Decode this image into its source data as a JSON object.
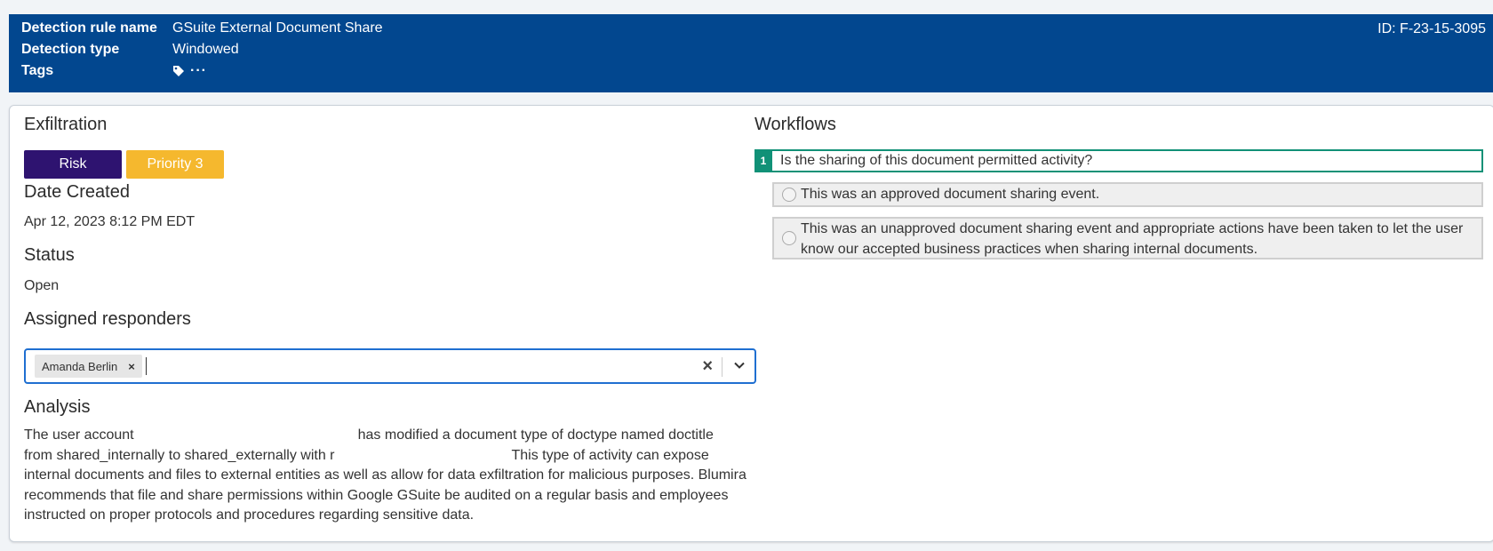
{
  "header": {
    "rule_name_label": "Detection rule name",
    "rule_name_value": "GSuite External Document Share",
    "type_label": "Detection type",
    "type_value": "Windowed",
    "tags_label": "Tags",
    "tags_more": "···",
    "id": "ID: F-23-15-3095",
    "tag_icon": "tag-icon"
  },
  "left": {
    "category": "Exfiltration",
    "badges": {
      "risk": "Risk",
      "priority": "Priority 3"
    },
    "date_created": {
      "label": "Date Created",
      "value": "Apr 12, 2023 8:12 PM EDT"
    },
    "status": {
      "label": "Status",
      "value": "Open"
    },
    "assigned": {
      "label": "Assigned responders",
      "chip": "Amanda Berlin",
      "chip_remove": "×",
      "clear": "×"
    },
    "analysis": {
      "label": "Analysis",
      "line1_a": "The user account",
      "line1_b": "has modified a document type of doctype named doctitle",
      "line2_a": "from shared_internally to shared_externally with r",
      "line2_b": "This type of activity can expose",
      "line3": "internal documents and files to external entities as well as allow for data exfiltration for malicious purposes. Blumira",
      "line4": "recommends that file and share permissions within Google GSuite be audited on a regular basis and employees",
      "line5": "instructed on proper protocols and procedures regarding sensitive data."
    }
  },
  "workflows": {
    "title": "Workflows",
    "question_number": "1",
    "question": "Is the sharing of this document permitted activity?",
    "options": [
      "This was an approved document sharing event.",
      "This was an unapproved document sharing event and appropriate actions have been taken to let the user",
      "know our accepted business practices when sharing internal documents."
    ]
  },
  "colors": {
    "header_bg": "#02478f",
    "risk": "#2e1370",
    "priority": "#f5b82e",
    "workflow_accent": "#119177",
    "focus": "#1f6fd1"
  }
}
